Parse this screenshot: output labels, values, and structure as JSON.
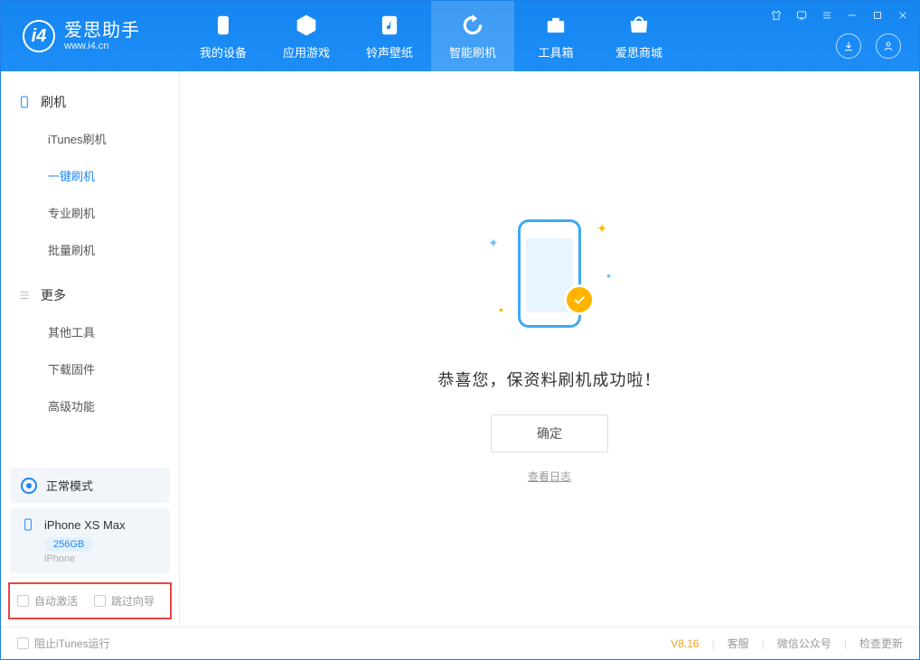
{
  "logo": {
    "title": "爱思助手",
    "subtitle": "www.i4.cn"
  },
  "nav": {
    "tabs": [
      {
        "label": "我的设备"
      },
      {
        "label": "应用游戏"
      },
      {
        "label": "铃声壁纸"
      },
      {
        "label": "智能刷机"
      },
      {
        "label": "工具箱"
      },
      {
        "label": "爱思商城"
      }
    ]
  },
  "sidebar": {
    "group_flash": "刷机",
    "items_flash": [
      {
        "label": "iTunes刷机"
      },
      {
        "label": "一键刷机"
      },
      {
        "label": "专业刷机"
      },
      {
        "label": "批量刷机"
      }
    ],
    "group_more": "更多",
    "items_more": [
      {
        "label": "其他工具"
      },
      {
        "label": "下载固件"
      },
      {
        "label": "高级功能"
      }
    ],
    "mode": "正常模式",
    "device_name": "iPhone XS Max",
    "device_storage": "256GB",
    "device_type": "iPhone",
    "chk_auto_activate": "自动激活",
    "chk_skip_guide": "跳过向导"
  },
  "main": {
    "success_text": "恭喜您，保资料刷机成功啦！",
    "confirm_label": "确定",
    "view_log": "查看日志"
  },
  "footer": {
    "block_itunes": "阻止iTunes运行",
    "version": "V8.16",
    "customer_service": "客服",
    "wechat": "微信公众号",
    "check_update": "检查更新"
  }
}
